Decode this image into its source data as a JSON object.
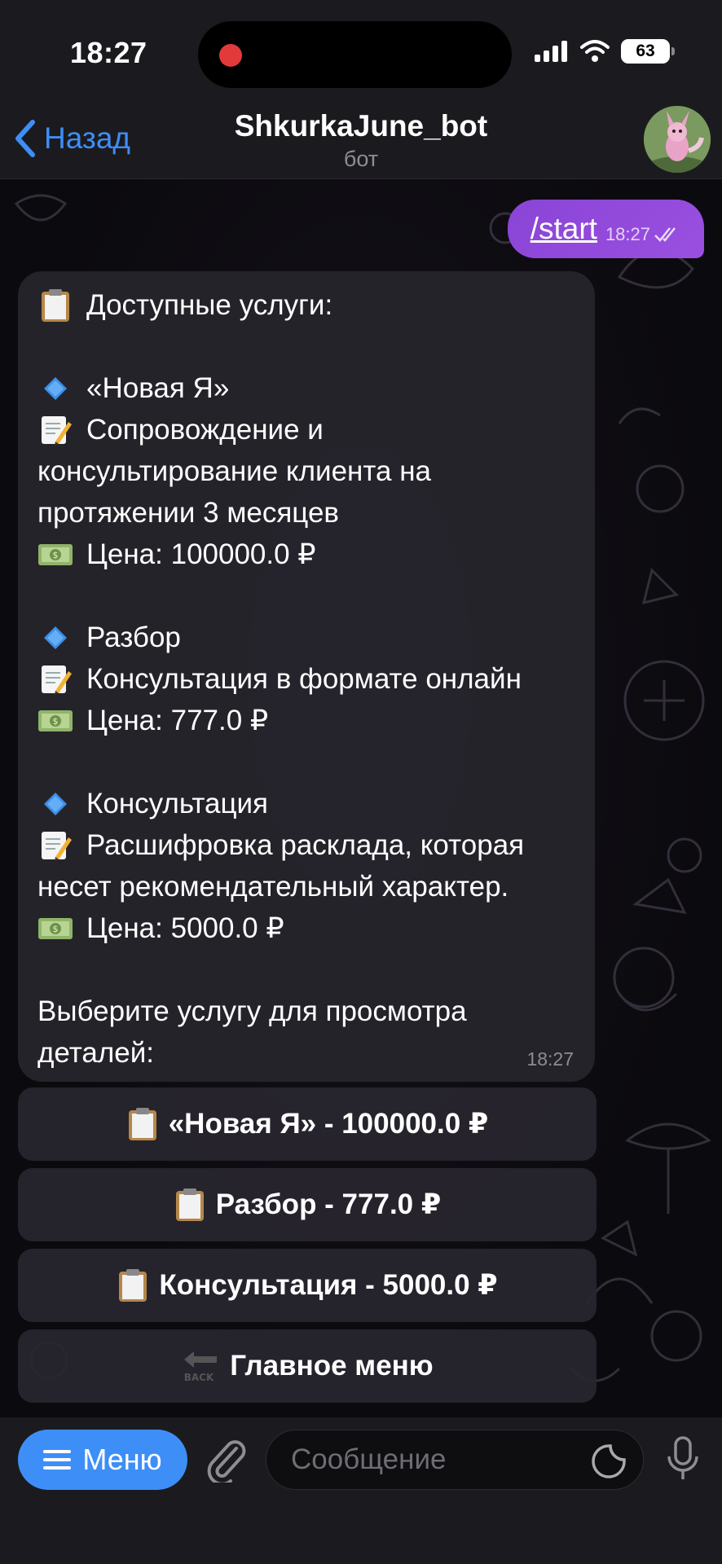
{
  "status_bar": {
    "time": "18:27",
    "battery": "63"
  },
  "header": {
    "back_label": "Назад",
    "title": "ShkurkaJune_bot",
    "subtitle": "бот"
  },
  "outgoing": {
    "text": "/start",
    "time": "18:27"
  },
  "incoming": {
    "heading": "Доступные услуги:",
    "services": [
      {
        "name": "«Новая Я»",
        "desc_lines": [
          "Сопровождение и",
          "консультирование клиента на",
          "протяжении 3 месяцев"
        ],
        "price": "Цена: 100000.0 ₽"
      },
      {
        "name": "Разбор",
        "desc_lines": [
          "Консультация в формате онлайн"
        ],
        "price": "Цена: 777.0 ₽"
      },
      {
        "name": "Консультация",
        "desc_lines": [
          "Расшифровка расклада, которая",
          "несет рекомендательный характер."
        ],
        "price": "Цена: 5000.0 ₽"
      }
    ],
    "footer_lines": [
      "Выберите услугу для просмотра",
      "деталей:"
    ],
    "time": "18:27"
  },
  "keyboard": [
    {
      "label": "«Новая Я» - 100000.0 ₽",
      "icon": "clipboard-icon"
    },
    {
      "label": "Разбор - 777.0 ₽",
      "icon": "clipboard-icon"
    },
    {
      "label": "Консультация - 5000.0 ₽",
      "icon": "clipboard-icon"
    },
    {
      "label": "Главное меню",
      "icon": "back-arrow-icon"
    }
  ],
  "input_bar": {
    "menu_label": "Меню",
    "placeholder": "Сообщение"
  },
  "colors": {
    "accent": "#3e8ef7",
    "outgoing_bubble": "#9a4fe0",
    "incoming_bubble": "#26242c"
  }
}
